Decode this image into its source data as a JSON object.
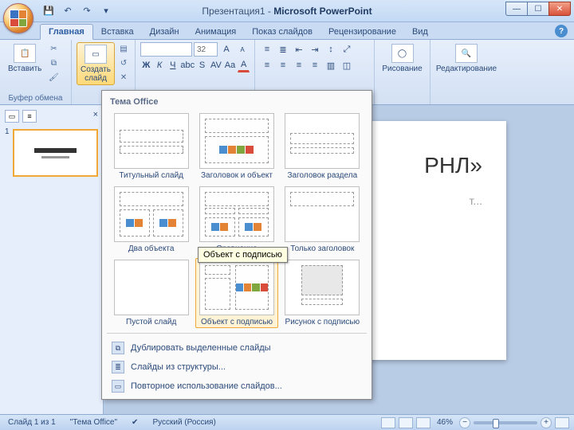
{
  "title": {
    "doc": "Презентация1",
    "app": "Microsoft PowerPoint"
  },
  "tabs": {
    "home": "Главная",
    "insert": "Вставка",
    "design": "Дизайн",
    "anim": "Анимация",
    "show": "Показ слайдов",
    "review": "Рецензирование",
    "view": "Вид"
  },
  "ribbon": {
    "paste": "Вставить",
    "clipboard_label": "Буфер обмена",
    "newslide": "Создать\nслайд",
    "font_size": "32",
    "drawing": "Рисование",
    "editing": "Редактирование"
  },
  "gallery": {
    "header": "Тема Office",
    "items": {
      "title_slide": "Титульный слайд",
      "title_content": "Заголовок и объект",
      "section": "Заголовок раздела",
      "two_content": "Два объекта",
      "comparison": "Сравнение",
      "title_only": "Только заголовок",
      "blank": "Пустой слайд",
      "content_caption": "Объект с подписью",
      "picture_caption": "Рисунок с подписью"
    },
    "menu": {
      "duplicate": "Дублировать выделенные слайды",
      "outline": "Слайды из структуры...",
      "reuse": "Повторное использование слайдов..."
    },
    "tooltip": "Объект с подписью"
  },
  "slide": {
    "title_fragment": "РНЛ»",
    "sub_fragment": "т..."
  },
  "status": {
    "slide_of": "Слайд 1 из 1",
    "theme": "\"Тема Office\"",
    "lang": "Русский (Россия)",
    "zoom": "46%"
  }
}
